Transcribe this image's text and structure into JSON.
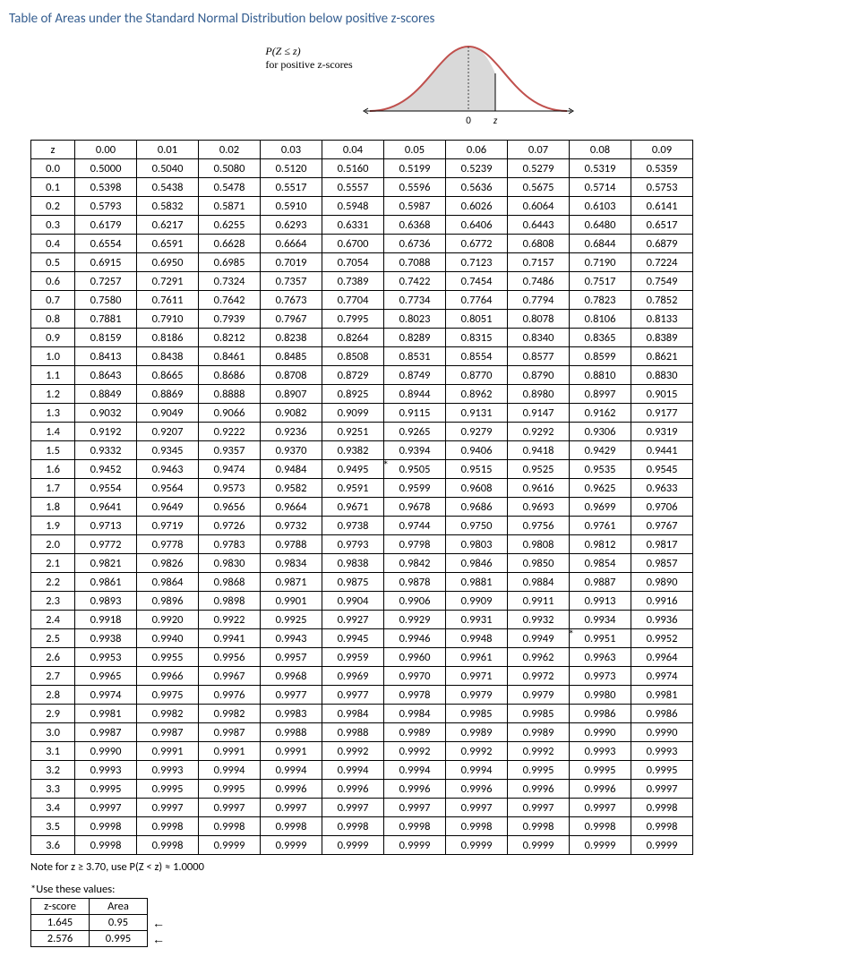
{
  "title": "Table of Areas under the Standard Normal Distribution below positive z-scores",
  "diagram": {
    "formula": "P(Z ≤ z)",
    "subtitle": "for positive z-scores",
    "axis_zero": "0",
    "axis_z": "z"
  },
  "table": {
    "corner": "z",
    "col_headers": [
      "0.00",
      "0.01",
      "0.02",
      "0.03",
      "0.04",
      "0.05",
      "0.06",
      "0.07",
      "0.08",
      "0.09"
    ],
    "rows": [
      {
        "z": "0.0",
        "v": [
          "0.5000",
          "0.5040",
          "0.5080",
          "0.5120",
          "0.5160",
          "0.5199",
          "0.5239",
          "0.5279",
          "0.5319",
          "0.5359"
        ]
      },
      {
        "z": "0.1",
        "v": [
          "0.5398",
          "0.5438",
          "0.5478",
          "0.5517",
          "0.5557",
          "0.5596",
          "0.5636",
          "0.5675",
          "0.5714",
          "0.5753"
        ]
      },
      {
        "z": "0.2",
        "v": [
          "0.5793",
          "0.5832",
          "0.5871",
          "0.5910",
          "0.5948",
          "0.5987",
          "0.6026",
          "0.6064",
          "0.6103",
          "0.6141"
        ]
      },
      {
        "z": "0.3",
        "v": [
          "0.6179",
          "0.6217",
          "0.6255",
          "0.6293",
          "0.6331",
          "0.6368",
          "0.6406",
          "0.6443",
          "0.6480",
          "0.6517"
        ]
      },
      {
        "z": "0.4",
        "v": [
          "0.6554",
          "0.6591",
          "0.6628",
          "0.6664",
          "0.6700",
          "0.6736",
          "0.6772",
          "0.6808",
          "0.6844",
          "0.6879"
        ]
      },
      {
        "z": "0.5",
        "v": [
          "0.6915",
          "0.6950",
          "0.6985",
          "0.7019",
          "0.7054",
          "0.7088",
          "0.7123",
          "0.7157",
          "0.7190",
          "0.7224"
        ]
      },
      {
        "z": "0.6",
        "v": [
          "0.7257",
          "0.7291",
          "0.7324",
          "0.7357",
          "0.7389",
          "0.7422",
          "0.7454",
          "0.7486",
          "0.7517",
          "0.7549"
        ]
      },
      {
        "z": "0.7",
        "v": [
          "0.7580",
          "0.7611",
          "0.7642",
          "0.7673",
          "0.7704",
          "0.7734",
          "0.7764",
          "0.7794",
          "0.7823",
          "0.7852"
        ]
      },
      {
        "z": "0.8",
        "v": [
          "0.7881",
          "0.7910",
          "0.7939",
          "0.7967",
          "0.7995",
          "0.8023",
          "0.8051",
          "0.8078",
          "0.8106",
          "0.8133"
        ]
      },
      {
        "z": "0.9",
        "v": [
          "0.8159",
          "0.8186",
          "0.8212",
          "0.8238",
          "0.8264",
          "0.8289",
          "0.8315",
          "0.8340",
          "0.8365",
          "0.8389"
        ]
      },
      {
        "z": "1.0",
        "v": [
          "0.8413",
          "0.8438",
          "0.8461",
          "0.8485",
          "0.8508",
          "0.8531",
          "0.8554",
          "0.8577",
          "0.8599",
          "0.8621"
        ]
      },
      {
        "z": "1.1",
        "v": [
          "0.8643",
          "0.8665",
          "0.8686",
          "0.8708",
          "0.8729",
          "0.8749",
          "0.8770",
          "0.8790",
          "0.8810",
          "0.8830"
        ]
      },
      {
        "z": "1.2",
        "v": [
          "0.8849",
          "0.8869",
          "0.8888",
          "0.8907",
          "0.8925",
          "0.8944",
          "0.8962",
          "0.8980",
          "0.8997",
          "0.9015"
        ]
      },
      {
        "z": "1.3",
        "v": [
          "0.9032",
          "0.9049",
          "0.9066",
          "0.9082",
          "0.9099",
          "0.9115",
          "0.9131",
          "0.9147",
          "0.9162",
          "0.9177"
        ]
      },
      {
        "z": "1.4",
        "v": [
          "0.9192",
          "0.9207",
          "0.9222",
          "0.9236",
          "0.9251",
          "0.9265",
          "0.9279",
          "0.9292",
          "0.9306",
          "0.9319"
        ]
      },
      {
        "z": "1.5",
        "v": [
          "0.9332",
          "0.9345",
          "0.9357",
          "0.9370",
          "0.9382",
          "0.9394",
          "0.9406",
          "0.9418",
          "0.9429",
          "0.9441"
        ]
      },
      {
        "z": "1.6",
        "v": [
          "0.9452",
          "0.9463",
          "0.9474",
          "0.9484",
          "0.9495",
          "0.9505",
          "0.9515",
          "0.9525",
          "0.9535",
          "0.9545"
        ]
      },
      {
        "z": "1.7",
        "v": [
          "0.9554",
          "0.9564",
          "0.9573",
          "0.9582",
          "0.9591",
          "0.9599",
          "0.9608",
          "0.9616",
          "0.9625",
          "0.9633"
        ]
      },
      {
        "z": "1.8",
        "v": [
          "0.9641",
          "0.9649",
          "0.9656",
          "0.9664",
          "0.9671",
          "0.9678",
          "0.9686",
          "0.9693",
          "0.9699",
          "0.9706"
        ]
      },
      {
        "z": "1.9",
        "v": [
          "0.9713",
          "0.9719",
          "0.9726",
          "0.9732",
          "0.9738",
          "0.9744",
          "0.9750",
          "0.9756",
          "0.9761",
          "0.9767"
        ]
      },
      {
        "z": "2.0",
        "v": [
          "0.9772",
          "0.9778",
          "0.9783",
          "0.9788",
          "0.9793",
          "0.9798",
          "0.9803",
          "0.9808",
          "0.9812",
          "0.9817"
        ]
      },
      {
        "z": "2.1",
        "v": [
          "0.9821",
          "0.9826",
          "0.9830",
          "0.9834",
          "0.9838",
          "0.9842",
          "0.9846",
          "0.9850",
          "0.9854",
          "0.9857"
        ]
      },
      {
        "z": "2.2",
        "v": [
          "0.9861",
          "0.9864",
          "0.9868",
          "0.9871",
          "0.9875",
          "0.9878",
          "0.9881",
          "0.9884",
          "0.9887",
          "0.9890"
        ]
      },
      {
        "z": "2.3",
        "v": [
          "0.9893",
          "0.9896",
          "0.9898",
          "0.9901",
          "0.9904",
          "0.9906",
          "0.9909",
          "0.9911",
          "0.9913",
          "0.9916"
        ]
      },
      {
        "z": "2.4",
        "v": [
          "0.9918",
          "0.9920",
          "0.9922",
          "0.9925",
          "0.9927",
          "0.9929",
          "0.9931",
          "0.9932",
          "0.9934",
          "0.9936"
        ]
      },
      {
        "z": "2.5",
        "v": [
          "0.9938",
          "0.9940",
          "0.9941",
          "0.9943",
          "0.9945",
          "0.9946",
          "0.9948",
          "0.9949",
          "0.9951",
          "0.9952"
        ]
      },
      {
        "z": "2.6",
        "v": [
          "0.9953",
          "0.9955",
          "0.9956",
          "0.9957",
          "0.9959",
          "0.9960",
          "0.9961",
          "0.9962",
          "0.9963",
          "0.9964"
        ]
      },
      {
        "z": "2.7",
        "v": [
          "0.9965",
          "0.9966",
          "0.9967",
          "0.9968",
          "0.9969",
          "0.9970",
          "0.9971",
          "0.9972",
          "0.9973",
          "0.9974"
        ]
      },
      {
        "z": "2.8",
        "v": [
          "0.9974",
          "0.9975",
          "0.9976",
          "0.9977",
          "0.9977",
          "0.9978",
          "0.9979",
          "0.9979",
          "0.9980",
          "0.9981"
        ]
      },
      {
        "z": "2.9",
        "v": [
          "0.9981",
          "0.9982",
          "0.9982",
          "0.9983",
          "0.9984",
          "0.9984",
          "0.9985",
          "0.9985",
          "0.9986",
          "0.9986"
        ]
      },
      {
        "z": "3.0",
        "v": [
          "0.9987",
          "0.9987",
          "0.9987",
          "0.9988",
          "0.9988",
          "0.9989",
          "0.9989",
          "0.9989",
          "0.9990",
          "0.9990"
        ]
      },
      {
        "z": "3.1",
        "v": [
          "0.9990",
          "0.9991",
          "0.9991",
          "0.9991",
          "0.9992",
          "0.9992",
          "0.9992",
          "0.9992",
          "0.9993",
          "0.9993"
        ]
      },
      {
        "z": "3.2",
        "v": [
          "0.9993",
          "0.9993",
          "0.9994",
          "0.9994",
          "0.9994",
          "0.9994",
          "0.9994",
          "0.9995",
          "0.9995",
          "0.9995"
        ]
      },
      {
        "z": "3.3",
        "v": [
          "0.9995",
          "0.9995",
          "0.9995",
          "0.9996",
          "0.9996",
          "0.9996",
          "0.9996",
          "0.9996",
          "0.9996",
          "0.9997"
        ]
      },
      {
        "z": "3.4",
        "v": [
          "0.9997",
          "0.9997",
          "0.9997",
          "0.9997",
          "0.9997",
          "0.9997",
          "0.9997",
          "0.9997",
          "0.9997",
          "0.9998"
        ]
      },
      {
        "z": "3.5",
        "v": [
          "0.9998",
          "0.9998",
          "0.9998",
          "0.9998",
          "0.9998",
          "0.9998",
          "0.9998",
          "0.9998",
          "0.9998",
          "0.9998"
        ]
      },
      {
        "z": "3.6",
        "v": [
          "0.9998",
          "0.9998",
          "0.9999",
          "0.9999",
          "0.9999",
          "0.9999",
          "0.9999",
          "0.9999",
          "0.9999",
          "0.9999"
        ]
      }
    ],
    "starred_cells": [
      {
        "row_z": "1.6",
        "col": "0.04"
      },
      {
        "row_z": "2.5",
        "col": "0.07"
      }
    ]
  },
  "note": "Note for z ≥ 3.70, use P(Z < z) ≈  1.0000",
  "use_values": {
    "heading": "*Use these values:",
    "cols": [
      "z-score",
      "Area"
    ],
    "rows": [
      {
        "z": "1.645",
        "area": "0.95"
      },
      {
        "z": "2.576",
        "area": "0.995"
      }
    ]
  }
}
